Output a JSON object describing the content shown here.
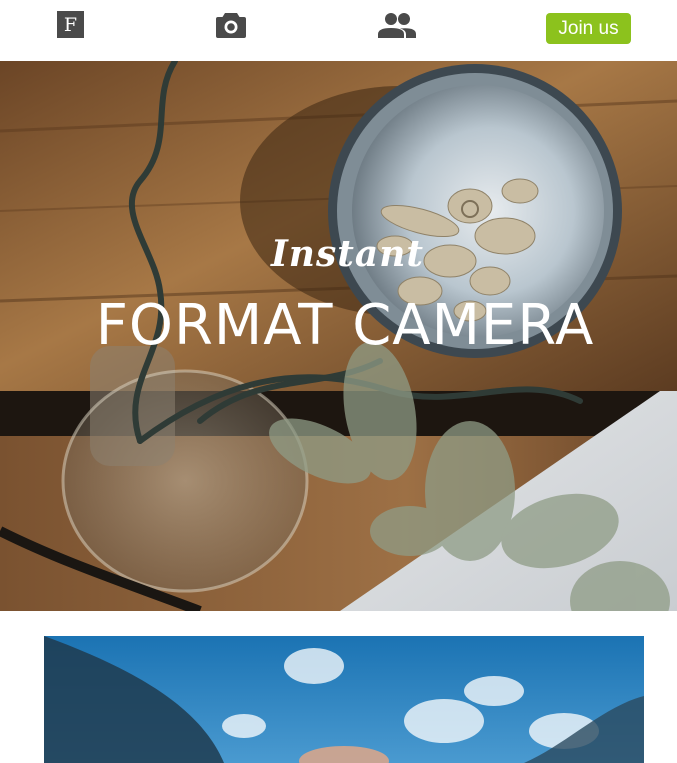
{
  "nav": {
    "logo_text": "F",
    "logo_icon": "f-logo-icon",
    "camera_icon": "camera-icon",
    "people_icon": "people-icon",
    "join_label": "Join us",
    "join_color": "#8cc21d"
  },
  "hero": {
    "script_text": "Instant",
    "title": "FORMAT CAMERA"
  }
}
